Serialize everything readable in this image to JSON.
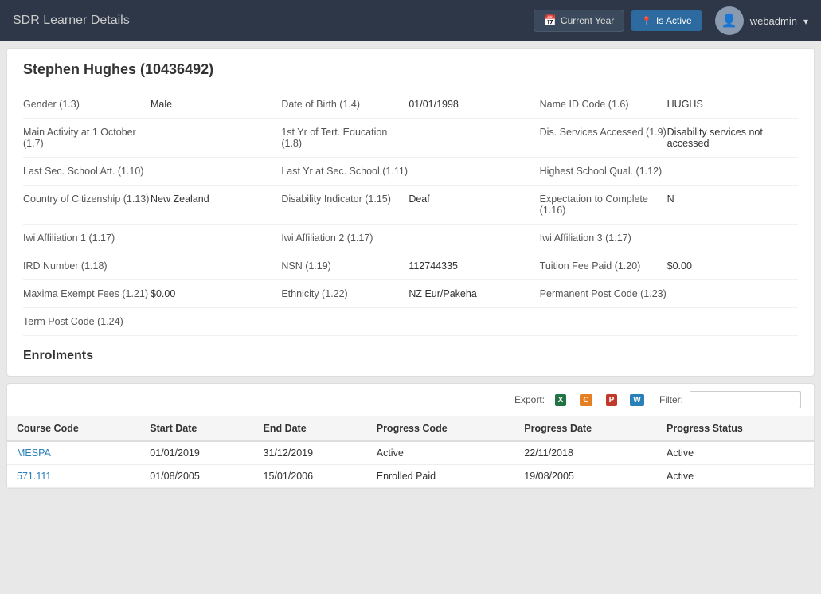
{
  "header": {
    "title": "SDR Learner Details",
    "current_year_label": "Current Year",
    "is_active_label": "Is Active",
    "username": "webadmin"
  },
  "learner": {
    "name": "Stephen Hughes (10436492)",
    "fields": [
      {
        "label": "Gender (1.3)",
        "value": "Male"
      },
      {
        "label": "Date of Birth (1.4)",
        "value": "01/01/1998"
      },
      {
        "label": "Name ID Code (1.6)",
        "value": "HUGHS"
      },
      {
        "label": "Main Activity at 1 October (1.7)",
        "value": ""
      },
      {
        "label": "1st Yr of Tert. Education (1.8)",
        "value": ""
      },
      {
        "label": "Dis. Services Accessed (1.9)",
        "value": "Disability services not accessed"
      },
      {
        "label": "Last Sec. School Att. (1.10)",
        "value": ""
      },
      {
        "label": "Last Yr at Sec. School (1.11)",
        "value": ""
      },
      {
        "label": "Highest School Qual. (1.12)",
        "value": ""
      },
      {
        "label": "Country of Citizenship (1.13)",
        "value": "New Zealand"
      },
      {
        "label": "Disability Indicator (1.15)",
        "value": "Deaf"
      },
      {
        "label": "Expectation to Complete (1.16)",
        "value": "N"
      },
      {
        "label": "Iwi Affiliation 1 (1.17)",
        "value": ""
      },
      {
        "label": "Iwi Affiliation 2 (1.17)",
        "value": ""
      },
      {
        "label": "Iwi Affiliation 3 (1.17)",
        "value": ""
      },
      {
        "label": "IRD Number (1.18)",
        "value": ""
      },
      {
        "label": "NSN (1.19)",
        "value": "112744335"
      },
      {
        "label": "Tuition Fee Paid (1.20)",
        "value": "$0.00"
      },
      {
        "label": "Maxima Exempt Fees (1.21)",
        "value": "$0.00"
      },
      {
        "label": "Ethnicity (1.22)",
        "value": "NZ Eur/Pakeha"
      },
      {
        "label": "Permanent Post Code (1.23)",
        "value": ""
      },
      {
        "label": "Term Post Code (1.24)",
        "value": ""
      }
    ]
  },
  "enrolments": {
    "section_title": "Enrolments",
    "export_label": "Export:",
    "filter_label": "Filter:",
    "filter_placeholder": "",
    "columns": [
      "Course Code",
      "Start Date",
      "End Date",
      "Progress Code",
      "Progress Date",
      "Progress Status"
    ],
    "rows": [
      {
        "course_code": "MESPA",
        "start_date": "01/01/2019",
        "end_date": "31/12/2019",
        "progress_code": "Active",
        "progress_date": "22/11/2018",
        "progress_status": "Active"
      },
      {
        "course_code": "571.111",
        "start_date": "01/08/2005",
        "end_date": "15/01/2006",
        "progress_code": "Enrolled Paid",
        "progress_date": "19/08/2005",
        "progress_status": "Active"
      }
    ]
  }
}
